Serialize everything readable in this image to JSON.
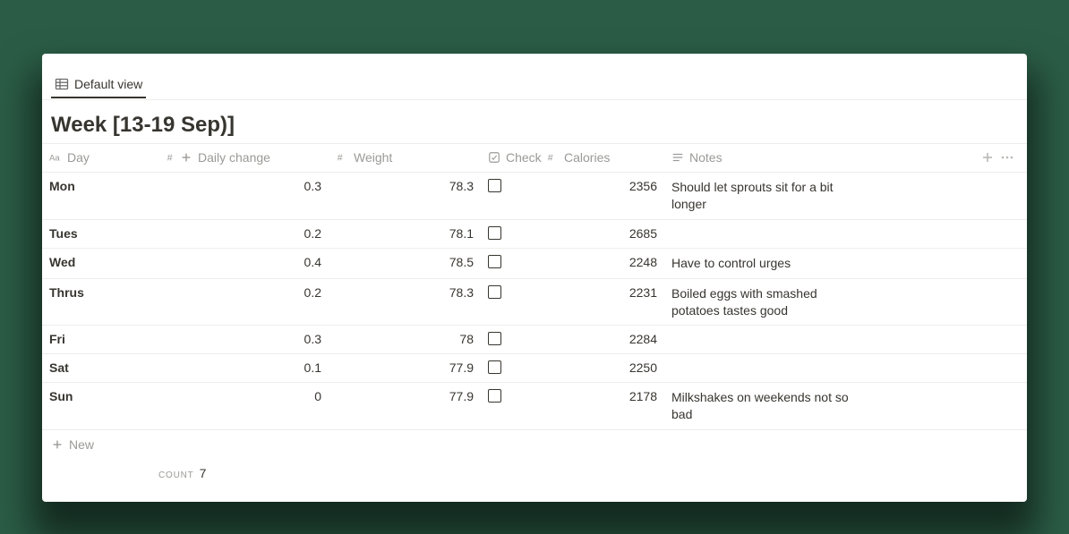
{
  "view": {
    "label": "Default view"
  },
  "title": "Week [13-19 Sep)]",
  "columns": {
    "day": "Day",
    "daily_change": "Daily change",
    "weight": "Weight",
    "check": "Check",
    "calories": "Calories",
    "notes": "Notes"
  },
  "rows": [
    {
      "day": "Mon",
      "change": "0.3",
      "weight": "78.3",
      "check": false,
      "calories": "2356",
      "notes": "Should let sprouts sit for a bit longer"
    },
    {
      "day": "Tues",
      "change": "0.2",
      "weight": "78.1",
      "check": false,
      "calories": "2685",
      "notes": ""
    },
    {
      "day": "Wed",
      "change": "0.4",
      "weight": "78.5",
      "check": false,
      "calories": "2248",
      "notes": "Have to control urges"
    },
    {
      "day": "Thrus",
      "change": "0.2",
      "weight": "78.3",
      "check": false,
      "calories": "2231",
      "notes": "Boiled eggs with smashed potatoes tastes good"
    },
    {
      "day": "Fri",
      "change": "0.3",
      "weight": "78",
      "check": false,
      "calories": "2284",
      "notes": ""
    },
    {
      "day": "Sat",
      "change": "0.1",
      "weight": "77.9",
      "check": false,
      "calories": "2250",
      "notes": ""
    },
    {
      "day": "Sun",
      "change": "0",
      "weight": "77.9",
      "check": false,
      "calories": "2178",
      "notes": "Milkshakes on weekends not so bad"
    }
  ],
  "new_label": "New",
  "footer": {
    "count_label": "COUNT",
    "count_value": "7"
  }
}
